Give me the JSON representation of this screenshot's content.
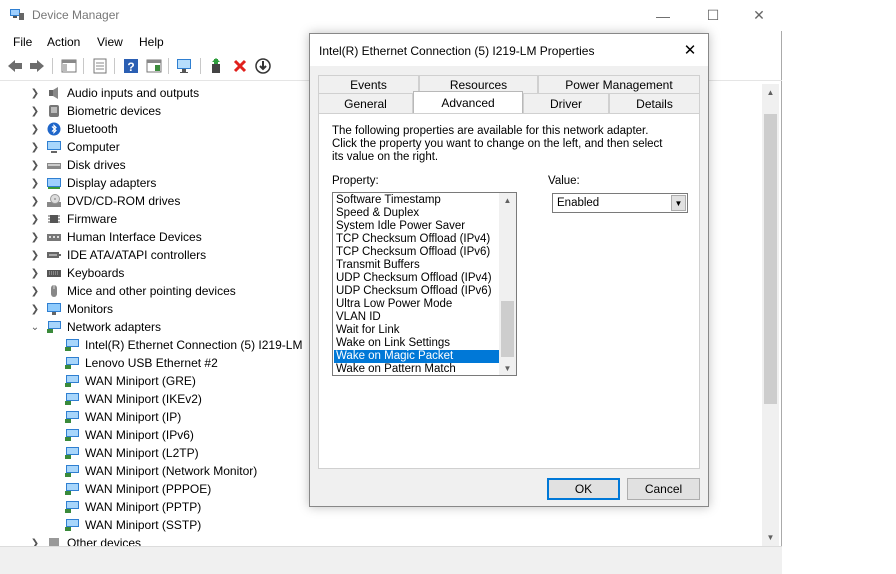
{
  "window": {
    "title": "Device Manager",
    "controls": {
      "minimize": "—",
      "maximize": "☐",
      "close": "✕"
    }
  },
  "menu": [
    "File",
    "Action",
    "View",
    "Help"
  ],
  "tree": {
    "categories": [
      {
        "label": "Audio inputs and outputs",
        "icon": "speaker-icon"
      },
      {
        "label": "Biometric devices",
        "icon": "biometric-icon"
      },
      {
        "label": "Bluetooth",
        "icon": "bluetooth-icon"
      },
      {
        "label": "Computer",
        "icon": "computer-icon"
      },
      {
        "label": "Disk drives",
        "icon": "disk-drive-icon"
      },
      {
        "label": "Display adapters",
        "icon": "display-adapter-icon"
      },
      {
        "label": "DVD/CD-ROM drives",
        "icon": "dvd-drive-icon"
      },
      {
        "label": "Firmware",
        "icon": "firmware-icon"
      },
      {
        "label": "Human Interface Devices",
        "icon": "hid-icon"
      },
      {
        "label": "IDE ATA/ATAPI controllers",
        "icon": "ide-controller-icon"
      },
      {
        "label": "Keyboards",
        "icon": "keyboard-icon"
      },
      {
        "label": "Mice and other pointing devices",
        "icon": "mouse-icon"
      },
      {
        "label": "Monitors",
        "icon": "monitor-icon"
      },
      {
        "label": "Network adapters",
        "icon": "network-adapter-icon"
      }
    ],
    "network_children": [
      "Intel(R) Ethernet Connection (5) I219-LM",
      "Lenovo USB Ethernet #2",
      "WAN Miniport (GRE)",
      "WAN Miniport (IKEv2)",
      "WAN Miniport (IP)",
      "WAN Miniport (IPv6)",
      "WAN Miniport (L2TP)",
      "WAN Miniport (Network Monitor)",
      "WAN Miniport (PPPOE)",
      "WAN Miniport (PPTP)",
      "WAN Miniport (SSTP)"
    ],
    "after": "Other devices"
  },
  "dialog": {
    "title": "Intel(R) Ethernet Connection (5) I219-LM Properties",
    "tabs_row1": [
      "Events",
      "Resources",
      "Power Management"
    ],
    "tabs_row2": [
      "General",
      "Advanced",
      "Driver",
      "Details"
    ],
    "active_tab": "Advanced",
    "description": "The following properties are available for this network adapter. Click the property you want to change on the left, and then select its value on the right.",
    "property_label": "Property:",
    "value_label": "Value:",
    "properties": [
      "Software Timestamp",
      "Speed & Duplex",
      "System Idle Power Saver",
      "TCP Checksum Offload (IPv4)",
      "TCP Checksum Offload (IPv6)",
      "Transmit Buffers",
      "UDP Checksum Offload (IPv4)",
      "UDP Checksum Offload (IPv6)",
      "Ultra Low Power Mode",
      "VLAN ID",
      "Wait for Link",
      "Wake on Link Settings",
      "Wake on Magic Packet",
      "Wake on Pattern Match"
    ],
    "selected_property": "Wake on Magic Packet",
    "value": "Enabled",
    "ok_label": "OK",
    "cancel_label": "Cancel"
  },
  "colors": {
    "selection": "#0078d7",
    "default_button_border": "#0078d7"
  }
}
